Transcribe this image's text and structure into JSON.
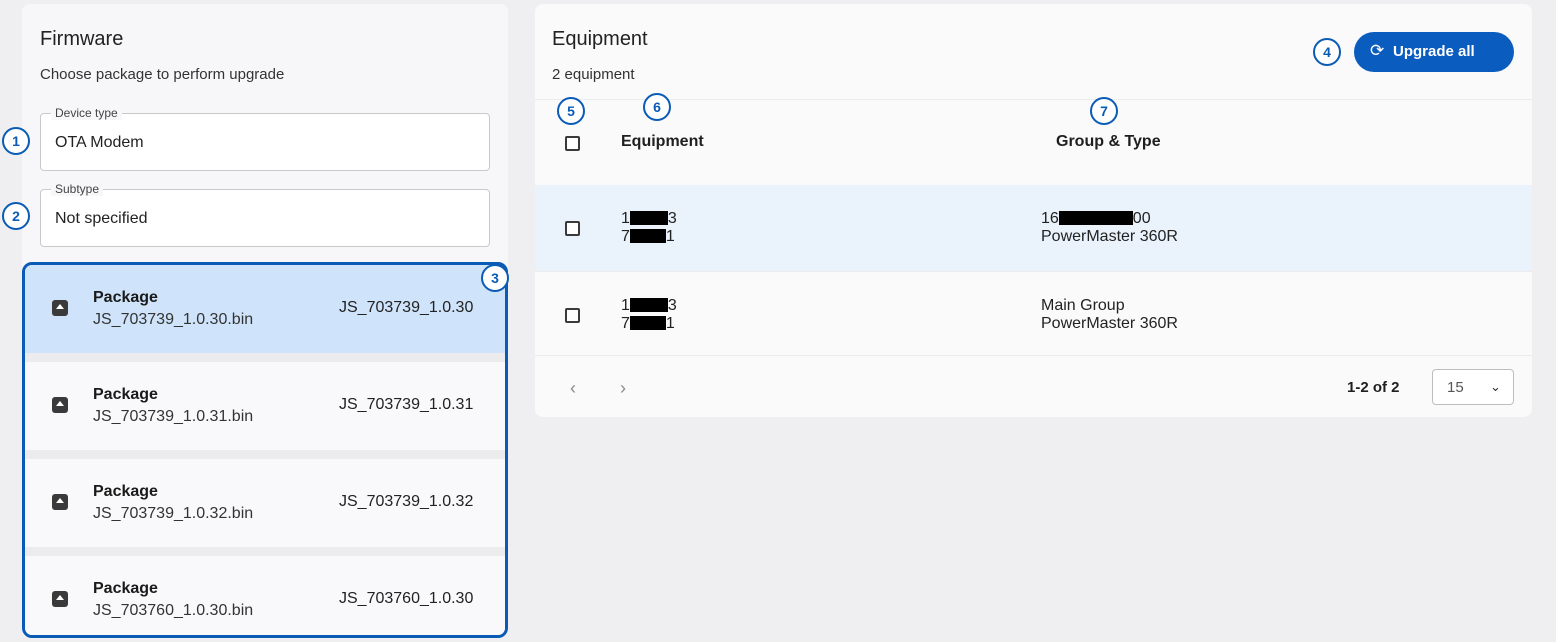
{
  "firmware": {
    "title": "Firmware",
    "subtitle": "Choose package to perform upgrade",
    "device_type": {
      "label": "Device type",
      "value": "OTA Modem"
    },
    "subtype": {
      "label": "Subtype",
      "value": "Not specified"
    },
    "packages": [
      {
        "name": "Package",
        "file": "JS_703739_1.0.30.bin",
        "version": "JS_703739_1.0.30",
        "selected": true
      },
      {
        "name": "Package",
        "file": "JS_703739_1.0.31.bin",
        "version": "JS_703739_1.0.31",
        "selected": false
      },
      {
        "name": "Package",
        "file": "JS_703739_1.0.32.bin",
        "version": "JS_703739_1.0.32",
        "selected": false
      },
      {
        "name": "Package",
        "file": "JS_703760_1.0.30.bin",
        "version": "JS_703760_1.0.30",
        "selected": false
      }
    ],
    "package_icon": "upload-archive-icon"
  },
  "equipment": {
    "title": "Equipment",
    "count": "2 equipment",
    "upgrade_all": {
      "label": "Upgrade all",
      "icon": "refresh-icon",
      "glyph": "⟳"
    },
    "columns": {
      "equipment": "Equipment",
      "group_type": "Group & Type"
    },
    "rows": [
      {
        "id_line1": [
          "1",
          "3"
        ],
        "id_line2": [
          "7",
          "1"
        ],
        "group": [
          "16",
          "00"
        ],
        "type": "PowerMaster 360R"
      },
      {
        "id_line1": [
          "1",
          "3"
        ],
        "id_line2": [
          "7",
          "1"
        ],
        "group": [
          "Main Group"
        ],
        "type": "PowerMaster 360R"
      }
    ],
    "pagination": {
      "prev": "‹",
      "next": "›",
      "range": "1-2 of 2",
      "page_size": "15",
      "page_size_chevron": "⌄"
    }
  },
  "callouts": [
    "1",
    "2",
    "3",
    "4",
    "5",
    "6",
    "7"
  ],
  "colors": {
    "accent": "#0b5cbf",
    "callout": "#0a5bb5",
    "selected_row": "#cfe4fa",
    "shaded_row": "#eaf2fb"
  }
}
